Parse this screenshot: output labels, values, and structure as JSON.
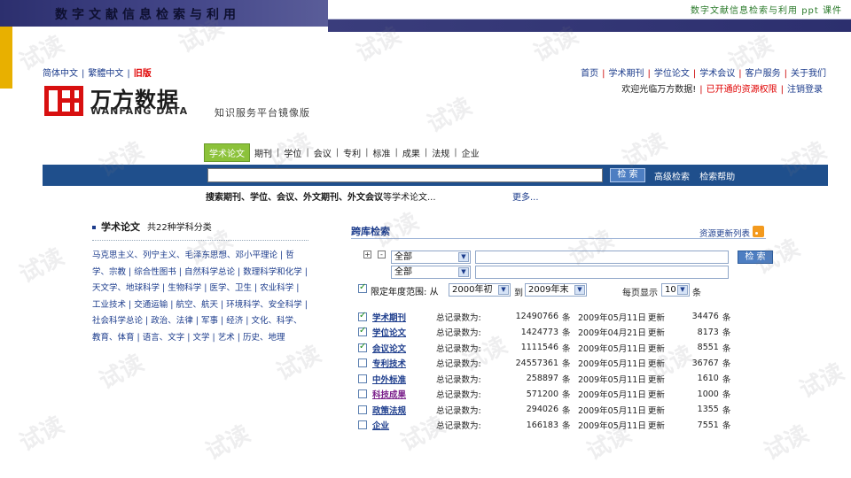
{
  "banner": {
    "title": "数字文献信息检索与利用",
    "caption": "数字文献信息检索与利用  ppt  课件"
  },
  "lang": {
    "simplified": "简体中文",
    "traditional": "繁體中文",
    "old": "旧版"
  },
  "topnav": {
    "items": [
      "首页",
      "学术期刊",
      "学位论文",
      "学术会议",
      "客户服务",
      "关于我们"
    ]
  },
  "welcome": {
    "greeting": "欢迎光临万方数据!",
    "permission": "已开通的资源权限",
    "logout": "注销登录"
  },
  "logo": {
    "cn": "万方数据",
    "en": "WANFANG DATA",
    "sub": "知识服务平台镜像版"
  },
  "tabs": [
    "学术论文",
    "期刊",
    "学位",
    "会议",
    "专利",
    "标准",
    "成果",
    "法规",
    "企业"
  ],
  "search": {
    "button": "检 索",
    "advanced": "高级检索",
    "help": "检索帮助",
    "hint_bold": "搜索期刊、学位、会议、外文期刊、外文会议",
    "hint_rest": "等学术论文...",
    "more": "更多..."
  },
  "left_panel": {
    "title": "学术论文",
    "subtitle": "共22种学科分类",
    "subjects": "马克思主义、列宁主义、毛泽东思想、邓小平理论 | 哲学、宗教 | 综合性图书 | 自然科学总论 | 数理科学和化学 | 天文学、地球科学 | 生物科学 | 医学、卫生 | 农业科学 | 工业技术 | 交通运输 | 航空、航天 | 环境科学、安全科学 | 社会科学总论 | 政治、法律 | 军事 | 经济 | 文化、科学、教育、体育 | 语言、文字 | 文学 | 艺术 | 历史、地理"
  },
  "right_panel": {
    "title": "跨库检索",
    "update": "资源更新列表",
    "plus": "+",
    "minus": "-",
    "field1": "全部",
    "field2": "全部",
    "button": "检 索",
    "filter_label": "限定年度范围:",
    "from": "从",
    "from_value": "2000年初",
    "to": "到",
    "to_value": "2009年末",
    "per_page_label": "每页显示",
    "per_page_value": "10",
    "per_page_unit": "条"
  },
  "databases": [
    {
      "name": "学术期刊",
      "checked": true,
      "label": "总记录数为:",
      "count": "12490766",
      "unit": "条",
      "date": "2009年05月11日",
      "update": "更新",
      "new": "34476",
      "new_unit": "条"
    },
    {
      "name": "学位论文",
      "checked": true,
      "label": "总记录数为:",
      "count": "1424773",
      "unit": "条",
      "date": "2009年04月21日",
      "update": "更新",
      "new": "8173",
      "new_unit": "条"
    },
    {
      "name": "会议论文",
      "checked": true,
      "label": "总记录数为:",
      "count": "1111546",
      "unit": "条",
      "date": "2009年05月11日",
      "update": "更新",
      "new": "8551",
      "new_unit": "条"
    },
    {
      "name": "专利技术",
      "checked": false,
      "label": "总记录数为:",
      "count": "24557361",
      "unit": "条",
      "date": "2009年05月11日",
      "update": "更新",
      "new": "36767",
      "new_unit": "条"
    },
    {
      "name": "中外标准",
      "checked": false,
      "label": "总记录数为:",
      "count": "258897",
      "unit": "条",
      "date": "2009年05月11日",
      "update": "更新",
      "new": "1610",
      "new_unit": "条"
    },
    {
      "name": "科技成果",
      "checked": false,
      "label": "总记录数为:",
      "count": "571200",
      "unit": "条",
      "date": "2009年05月11日",
      "update": "更新",
      "new": "1000",
      "new_unit": "条"
    },
    {
      "name": "政策法规",
      "checked": false,
      "label": "总记录数为:",
      "count": "294026",
      "unit": "条",
      "date": "2009年05月11日",
      "update": "更新",
      "new": "1355",
      "new_unit": "条"
    },
    {
      "name": "企业",
      "checked": false,
      "label": "总记录数为:",
      "count": "166183",
      "unit": "条",
      "date": "2009年05月11日",
      "update": "更新",
      "new": "7551",
      "new_unit": "条"
    }
  ],
  "watermark": "试读",
  "colors": {
    "nav_blue": "#1c3c8c",
    "red": "#e00000",
    "tab_green": "#8cc23a",
    "bar_blue": "#1f4f8c",
    "banner_dark": "#2c2f6e"
  }
}
